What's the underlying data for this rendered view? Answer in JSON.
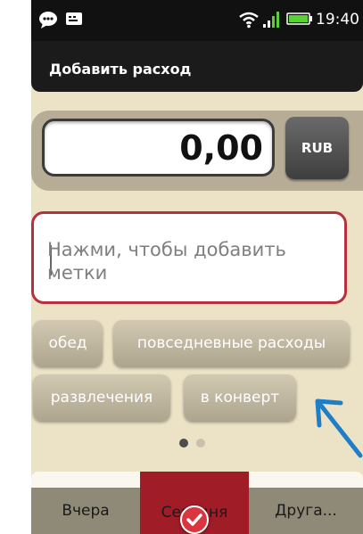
{
  "statusbar": {
    "time": "19:40"
  },
  "header": {
    "title": "Добавить расход"
  },
  "amount": {
    "value": "0,00",
    "currency": "RUB"
  },
  "tags_input": {
    "placeholder": "Нажми, чтобы добавить метки"
  },
  "chips": [
    {
      "label": "обед"
    },
    {
      "label": "повседневные расходы"
    },
    {
      "label": "развлечения"
    },
    {
      "label": "в конверт"
    }
  ],
  "pager": {
    "pages": 2,
    "current": 1
  },
  "tabs": [
    {
      "label": "Вчера"
    },
    {
      "label": "Сегодня"
    },
    {
      "label": "Друга..."
    }
  ],
  "colors": {
    "background": "#ece2c6",
    "accent": "#b5313c",
    "arrow": "#1e7fc8"
  }
}
